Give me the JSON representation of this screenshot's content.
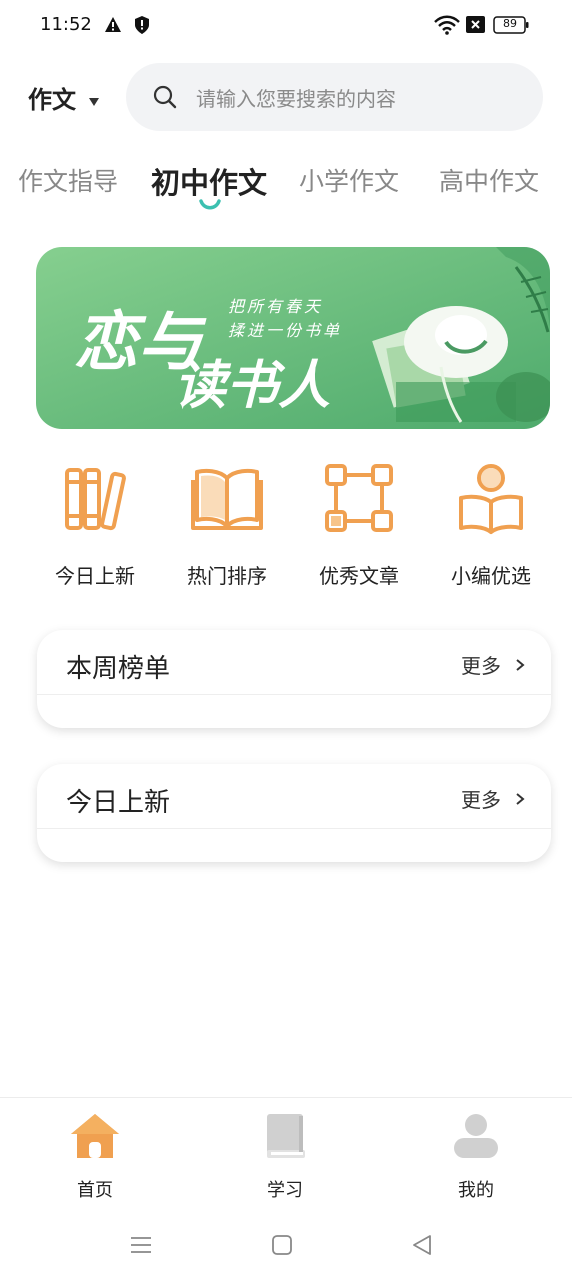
{
  "status_bar": {
    "time": "11:52",
    "battery": "89"
  },
  "header": {
    "category_label": "作文",
    "search_placeholder": "请输入您要搜索的内容"
  },
  "tabs": [
    {
      "label": "作文指导",
      "active": false
    },
    {
      "label": "初中作文",
      "active": true
    },
    {
      "label": "小学作文",
      "active": false
    },
    {
      "label": "高中作文",
      "active": false
    }
  ],
  "banner": {
    "big_text_1": "恋与",
    "big_text_2": "读书人",
    "small_text_1": "把所有春天",
    "small_text_2": "揉进一份书单"
  },
  "features": [
    {
      "label": "今日上新",
      "icon": "books-icon"
    },
    {
      "label": "热门排序",
      "icon": "open-book-icon"
    },
    {
      "label": "优秀文章",
      "icon": "network-icon"
    },
    {
      "label": "小编优选",
      "icon": "reader-icon"
    }
  ],
  "sections": [
    {
      "title": "本周榜单",
      "more_label": "更多"
    },
    {
      "title": "今日上新",
      "more_label": "更多"
    }
  ],
  "bottom_nav": [
    {
      "label": "首页",
      "icon": "home-icon",
      "active": true
    },
    {
      "label": "学习",
      "icon": "book-icon",
      "active": false
    },
    {
      "label": "我的",
      "icon": "user-icon",
      "active": false
    }
  ],
  "colors": {
    "accent": "#f0a050",
    "tab_indicator": "#3cc0b0",
    "banner_green": "#66bb7a",
    "inactive_icon": "#d0d0d0"
  }
}
